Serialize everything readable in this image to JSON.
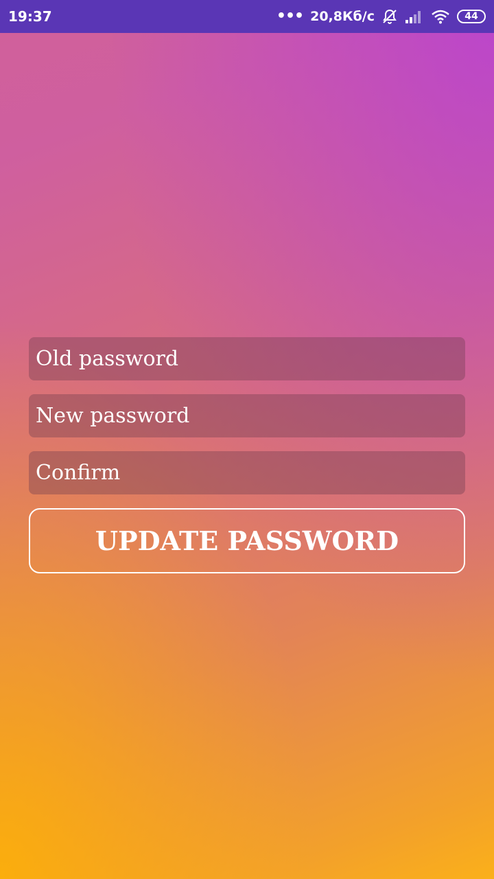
{
  "status_bar": {
    "time": "19:37",
    "dots": "•••",
    "network_speed": "20,8Кб/с",
    "icons": [
      "alarm-off-icon",
      "signal-icon",
      "wifi-icon"
    ],
    "battery": "44",
    "background": "#5a36b5"
  },
  "form": {
    "old_password": {
      "placeholder": "Old password",
      "value": ""
    },
    "new_password": {
      "placeholder": "New password",
      "value": ""
    },
    "confirm": {
      "placeholder": "Confirm",
      "value": ""
    },
    "update_button_label": "UPDATE PASSWORD"
  },
  "colors": {
    "gradient_top_right": "#b43cdc",
    "gradient_mid": "#d86e7c",
    "gradient_bottom_left": "#fbb01a",
    "field_bg": "rgba(110,60,80,0.38)",
    "text": "#ffffff"
  }
}
